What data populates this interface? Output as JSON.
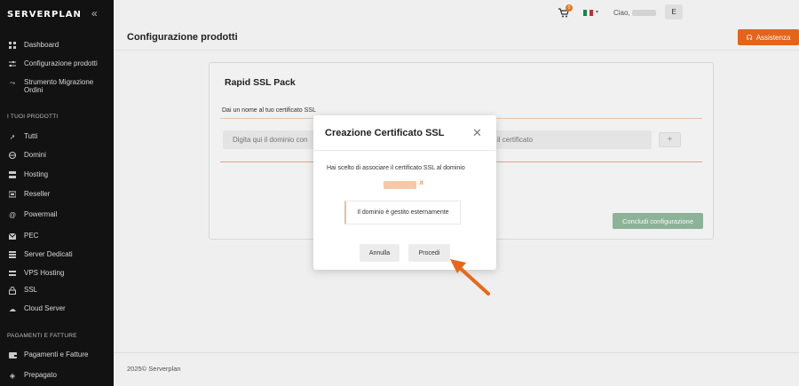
{
  "brand": {
    "name_a": "SERVER",
    "name_b": "PLAN",
    "accent": "#e8671b"
  },
  "sidebar": {
    "collapse_icon": "double-chevron-left-icon",
    "items": [
      {
        "label": "Dashboard",
        "icon": "grid-icon"
      },
      {
        "label": "Configurazione prodotti",
        "icon": "sliders-icon"
      },
      {
        "label": "Strumento Migrazione Ordini",
        "icon": "migrate-icon"
      }
    ],
    "section1": "I TUOI PRODOTTI",
    "products": [
      {
        "label": "Tutti",
        "icon": "rocket-icon"
      },
      {
        "label": "Domini",
        "icon": "globe-icon"
      },
      {
        "label": "Hosting",
        "icon": "server-icon"
      },
      {
        "label": "Reseller",
        "icon": "reseller-icon"
      },
      {
        "label": "Powermail",
        "icon": "at-icon"
      },
      {
        "label": "PEC",
        "icon": "mail-icon"
      },
      {
        "label": "Server Dedicati",
        "icon": "dedicated-icon"
      },
      {
        "label": "VPS Hosting",
        "icon": "vps-icon"
      },
      {
        "label": "SSL",
        "icon": "lock-icon"
      },
      {
        "label": "Cloud Server",
        "icon": "cloud-icon"
      }
    ],
    "section2": "PAGAMENTI E FATTURE",
    "payments": [
      {
        "label": "Pagamenti e Fatture",
        "icon": "wallet-icon"
      },
      {
        "label": "Prepagato",
        "icon": "tag-icon"
      }
    ]
  },
  "topbar": {
    "cart_count": "0",
    "greeting": "Ciao,",
    "avatar_initial": "E",
    "flag_colors": [
      "#009246",
      "#ffffff",
      "#ce2b37"
    ]
  },
  "header": {
    "title": "Configurazione prodotti",
    "assist_label": "Assistenza"
  },
  "card": {
    "title": "Rapid SSL Pack",
    "field_label": "Dai un nome al tuo certificato SSL",
    "input_placeholder_left": "Digita qui il dominio con",
    "input_placeholder_right": "il certificato",
    "plus_label": "+",
    "finish_label": "Concludi configurazione"
  },
  "modal": {
    "title": "Creazione Certificato SSL",
    "close_icon": "close-icon",
    "message": "Hai scelto di associare il certificato SSL al dominio",
    "domain_tld": ".it",
    "notice": "Il dominio è gestito esternamente",
    "cancel_label": "Annulla",
    "proceed_label": "Procedi"
  },
  "footer": {
    "text": "2025© Serverplan"
  }
}
